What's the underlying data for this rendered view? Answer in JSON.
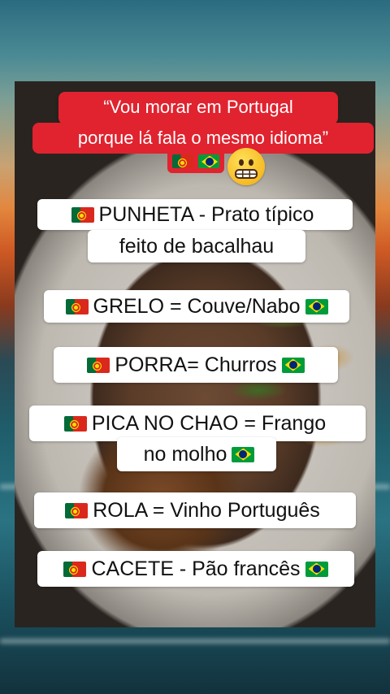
{
  "headline": {
    "line1": "“Vou morar em Portugal",
    "line2": "porque lá fala o mesmo idioma”",
    "flags": [
      "portugal-flag-icon",
      "brazil-flag-icon"
    ],
    "emoji": "grimacing-face-icon"
  },
  "captions": [
    {
      "text_line1": "PUNHETA - Prato típico",
      "text_line2": "feito de bacalhau"
    },
    {
      "text": "GRELO = Couve/Nabo"
    },
    {
      "text": "PORRA= Churros"
    },
    {
      "text_line1": "PICA NO CHAO = Frango",
      "text_line2": "no molho"
    },
    {
      "text": "ROLA = Vinho Português"
    },
    {
      "text": "CACETE - Pão francês"
    }
  ],
  "colors": {
    "headline_bg": "#e0232f",
    "caption_bg": "#ffffff",
    "caption_text": "#111111"
  }
}
